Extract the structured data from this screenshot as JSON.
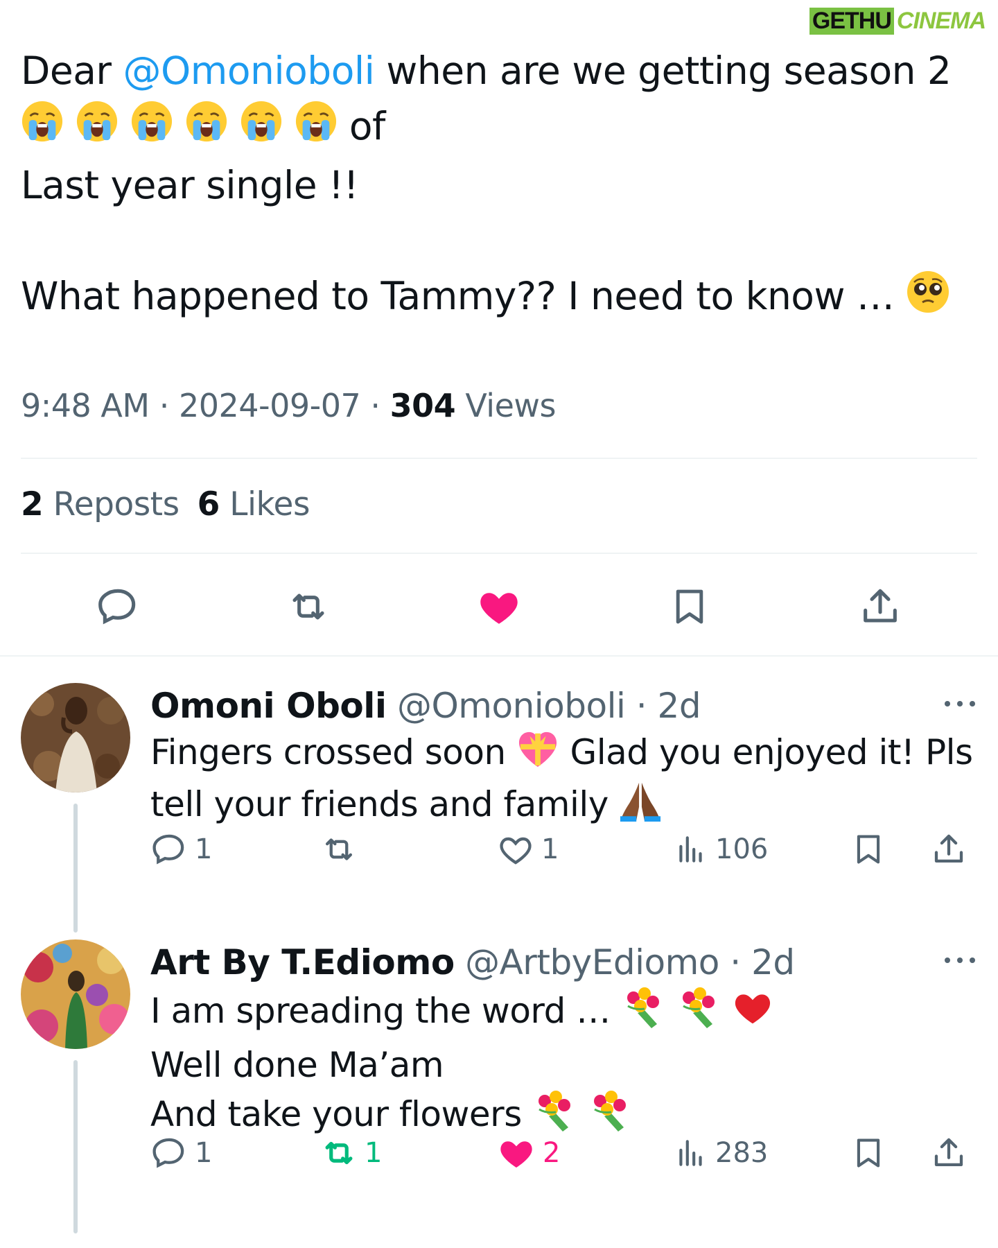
{
  "watermark": {
    "part1": "GETHU",
    "part2": "CINEMA"
  },
  "main_tweet": {
    "line1_before": "Dear ",
    "mention": "@Omonioboli",
    "line1_after": " when are we getting season 2",
    "line2_after_emojis": " of",
    "line3": "Last year single !!",
    "line4": "What happened to Tammy?? I need to know … ",
    "meta": {
      "time": "9:48 AM",
      "date": "2024-09-07",
      "views_count": "304",
      "views_label": " Views",
      "sep": " · "
    },
    "stats": {
      "reposts_count": "2",
      "reposts_label": " Reposts",
      "likes_count": "6",
      "likes_label": " Likes"
    },
    "liked": true
  },
  "replies": [
    {
      "name": "Omoni Oboli",
      "handle": "@Omonioboli",
      "time": " · 2d",
      "text_line1": "Fingers crossed soon ",
      "text_line1_b": " Glad you enjoyed it! Pls",
      "text_line2": "tell your friends and family ",
      "actions": {
        "replies": "1",
        "reposts": "",
        "likes": "1",
        "views": "106"
      }
    },
    {
      "name": "Art By T.Ediomo",
      "handle": "@ArtbyEdiomo",
      "time": " · 2d",
      "text_line1": "I am spreading the word … ",
      "text_line2": "Well done Ma’am",
      "text_line3": "And take your flowers ",
      "actions": {
        "replies": "1",
        "reposts": "1",
        "likes": "2",
        "views": "283"
      }
    }
  ],
  "colors": {
    "accent": "#1d9bf0",
    "like": "#f91880",
    "repost": "#00ba7c",
    "muted": "#536471"
  }
}
